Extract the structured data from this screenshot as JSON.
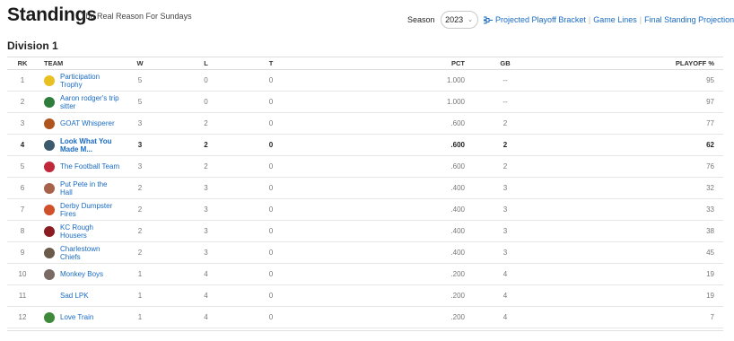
{
  "page": {
    "title": "Standings",
    "subtitle": "The Real Reason For Sundays",
    "season_label": "Season",
    "season_value": "2023",
    "links": [
      "Projected Playoff Bracket",
      "Game Lines",
      "Final Standing Projections"
    ],
    "division": "Division 1"
  },
  "table": {
    "headers": {
      "rk": "RK",
      "team": "TEAM",
      "w": "W",
      "l": "L",
      "t": "T",
      "pct": "PCT",
      "gb": "GB",
      "playoff": "PLAYOFF %"
    },
    "rows": [
      {
        "rk": "1",
        "team": "Participation Trophy",
        "w": "5",
        "l": "0",
        "t": "0",
        "pct": "1.000",
        "gb": "--",
        "playoff": "95",
        "logo": "#e8c020"
      },
      {
        "rk": "2",
        "team": "Aaron rodger's trip sitter",
        "w": "5",
        "l": "0",
        "t": "0",
        "pct": "1.000",
        "gb": "--",
        "playoff": "97",
        "logo": "#2f7d3a"
      },
      {
        "rk": "3",
        "team": "GOAT Whisperer",
        "w": "3",
        "l": "2",
        "t": "0",
        "pct": ".600",
        "gb": "2",
        "playoff": "77",
        "logo": "#b0541e"
      },
      {
        "rk": "4",
        "team": "Look What You Made M...",
        "w": "3",
        "l": "2",
        "t": "0",
        "pct": ".600",
        "gb": "2",
        "playoff": "62",
        "logo": "#3c5a6e"
      },
      {
        "rk": "5",
        "team": "The Football Team",
        "w": "3",
        "l": "2",
        "t": "0",
        "pct": ".600",
        "gb": "2",
        "playoff": "76",
        "logo": "#c0283a"
      },
      {
        "rk": "6",
        "team": "Put Pete in the Hall",
        "w": "2",
        "l": "3",
        "t": "0",
        "pct": ".400",
        "gb": "3",
        "playoff": "32",
        "logo": "#a8624a"
      },
      {
        "rk": "7",
        "team": "Derby Dumpster Fires",
        "w": "2",
        "l": "3",
        "t": "0",
        "pct": ".400",
        "gb": "3",
        "playoff": "33",
        "logo": "#d0502a"
      },
      {
        "rk": "8",
        "team": "KC Rough Housers",
        "w": "2",
        "l": "3",
        "t": "0",
        "pct": ".400",
        "gb": "3",
        "playoff": "38",
        "logo": "#8a1c22"
      },
      {
        "rk": "9",
        "team": "Charlestown Chiefs",
        "w": "2",
        "l": "3",
        "t": "0",
        "pct": ".400",
        "gb": "3",
        "playoff": "45",
        "logo": "#6a5a4a"
      },
      {
        "rk": "10",
        "team": "Monkey Boys",
        "w": "1",
        "l": "4",
        "t": "0",
        "pct": ".200",
        "gb": "4",
        "playoff": "19",
        "logo": "#7a6a64"
      },
      {
        "rk": "11",
        "team": "Sad LPK",
        "w": "1",
        "l": "4",
        "t": "0",
        "pct": ".200",
        "gb": "4",
        "playoff": "19",
        "logo": ""
      },
      {
        "rk": "12",
        "team": "Love Train",
        "w": "1",
        "l": "4",
        "t": "0",
        "pct": ".200",
        "gb": "4",
        "playoff": "7",
        "logo": "#3f8a3a"
      }
    ]
  },
  "colors": {
    "link": "#1a6bc4",
    "highlight_row": "#222222"
  }
}
